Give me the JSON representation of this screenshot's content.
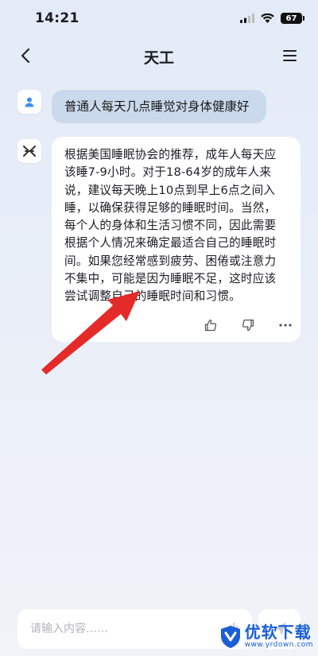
{
  "status_bar": {
    "time": "14:21",
    "battery": "67"
  },
  "nav": {
    "title": "天工"
  },
  "chat": {
    "user_message": "普通人每天几点睡觉对身体健康好",
    "bot_message": "根据美国睡眠协会的推荐，成年人每天应该睡7-9小时。对于18-64岁的成年人来说，建议每天晚上10点到早上6点之间入睡，以确保获得足够的睡眠时间。当然，每个人的身体和生活习惯不同，因此需要根据个人情况来确定最适合自己的睡眠时间。如果您经常感到疲劳、困倦或注意力不集中，可能是因为睡眠不足，这时应该尝试调整自己的睡眠时间和习惯。"
  },
  "input": {
    "placeholder": "请输入内容……"
  },
  "watermark": {
    "title": "优软下载",
    "url": "www.yrdown.com"
  },
  "colors": {
    "accent": "#1b5fd6",
    "arrow": "#e52a2a",
    "user_bubble": "#cbd9ec"
  }
}
